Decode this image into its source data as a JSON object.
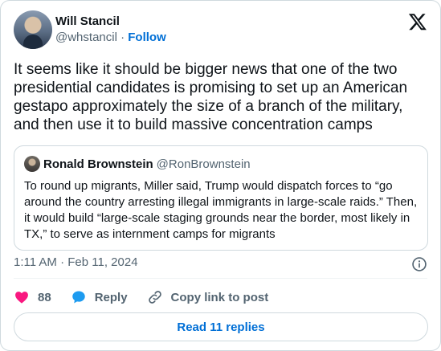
{
  "author": {
    "name": "Will Stancil",
    "handle": "@whstancil",
    "separator": "·",
    "follow_label": "Follow"
  },
  "tweet": {
    "text": "It seems like it should be bigger news that one of the two presidential candidates is promising to set up an American gestapo approximately the size of a branch of the military, and then use it to build massive concentration camps",
    "timestamp": "1:11 AM · Feb 11, 2024"
  },
  "quoted": {
    "name": "Ronald Brownstein",
    "handle": "@RonBrownstein",
    "text": "To round up migrants, Miller said, Trump would dispatch forces to “go around the country arresting illegal immigrants in large-scale raids.” Then, it would build “large-scale staging grounds near the border, most likely in TX,” to serve as internment camps for migrants"
  },
  "actions": {
    "like_count": "88",
    "reply_label": "Reply",
    "copy_label": "Copy link to post"
  },
  "read_replies_label": "Read 11 replies",
  "icons": {
    "logo": "x-logo-icon",
    "info": "info-icon",
    "like": "heart-icon",
    "reply": "speech-bubble-icon",
    "copy": "link-icon"
  },
  "colors": {
    "like": "#f91880",
    "reply": "#1d9bf0",
    "link": "#006fd6",
    "muted": "#536471",
    "border": "#cfd9de"
  }
}
